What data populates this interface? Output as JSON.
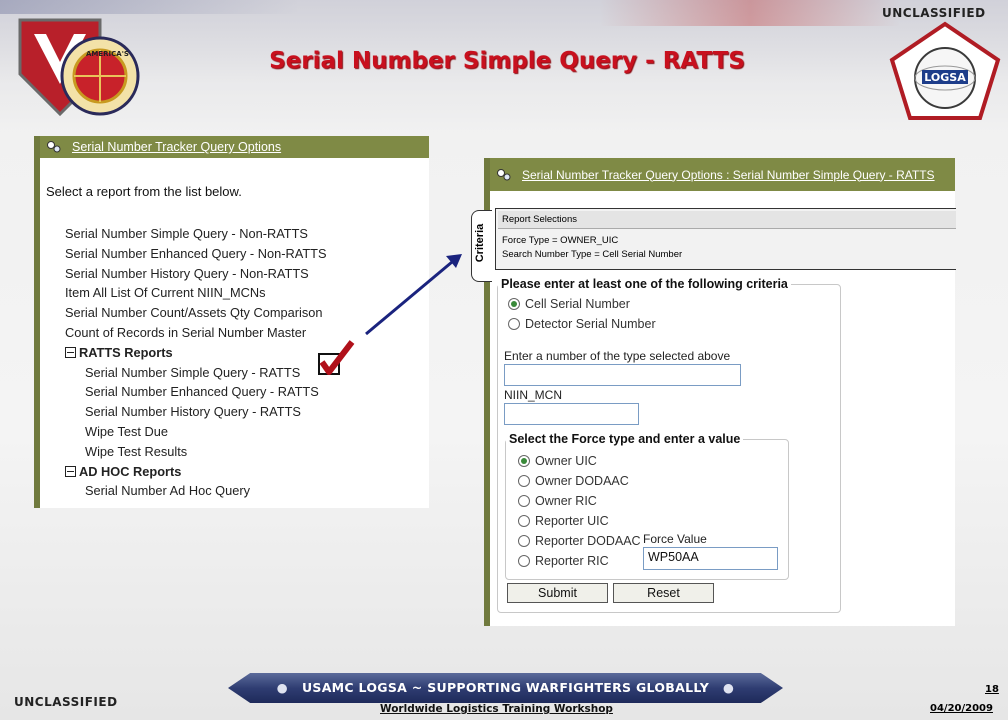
{
  "slide": {
    "title": "Serial Number Simple Query - RATTS",
    "classification_top": "UNCLASSIFIED",
    "classification_bottom": "UNCLASSIFIED",
    "banner": "USAMC LOGSA ~ SUPPORTING WARFIGHTERS GLOBALLY",
    "workshop": "Worldwide Logistics Training Workshop",
    "page_number": "18",
    "date": "04/20/2009"
  },
  "logos": {
    "left_seal_text": "AMERICA'S ARSENAL FOR THE BRAVE",
    "right_logo_text": "LOGSA"
  },
  "left_panel": {
    "header": "Serial Number Tracker Query Options",
    "prompt": "Select a report from the list below.",
    "items": [
      {
        "label": "Serial Number Simple Query - Non-RATTS"
      },
      {
        "label": "Serial Number Enhanced Query - Non-RATTS"
      },
      {
        "label": "Serial Number History Query - Non-RATTS"
      },
      {
        "label": "Item All List Of Current NIIN_MCNs"
      },
      {
        "label": "Serial Number Count/Assets Qty Comparison"
      },
      {
        "label": "Count of Records in Serial Number Master"
      }
    ],
    "ratts_group": {
      "label": "RATTS Reports",
      "items": [
        {
          "label": "Serial Number Simple Query - RATTS"
        },
        {
          "label": "Serial Number Enhanced Query - RATTS"
        },
        {
          "label": "Serial Number History Query - RATTS"
        },
        {
          "label": "Wipe Test Due"
        },
        {
          "label": "Wipe Test Results"
        }
      ]
    },
    "adhoc_group": {
      "label": "AD HOC Reports",
      "items": [
        {
          "label": "Serial Number Ad Hoc Query"
        }
      ]
    }
  },
  "right_panel": {
    "header": "Serial Number Tracker Query Options : Serial Number Simple Query - RATTS",
    "criteria_tab": "Criteria",
    "report_selections": {
      "title": "Report Selections",
      "line1": "Force Type = OWNER_UIC",
      "line2": "Search Number Type = Cell Serial Number"
    },
    "criteria_fieldset": {
      "legend": "Please enter at least one of the following criteria",
      "options": [
        {
          "label": "Cell Serial Number",
          "selected": true
        },
        {
          "label": "Detector Serial Number",
          "selected": false
        }
      ],
      "number_label": "Enter a number of the type selected above",
      "number_value": "",
      "niin_label": "NIIN_MCN",
      "niin_value": ""
    },
    "force_fieldset": {
      "legend": "Select the Force type and enter a value",
      "options": [
        {
          "label": "Owner UIC",
          "selected": true
        },
        {
          "label": "Owner DODAAC",
          "selected": false
        },
        {
          "label": "Owner RIC",
          "selected": false
        },
        {
          "label": "Reporter UIC",
          "selected": false
        },
        {
          "label": "Reporter DODAAC",
          "selected": false
        },
        {
          "label": "Reporter RIC",
          "selected": false
        }
      ],
      "force_value_label": "Force Value",
      "force_value": "WP50AA"
    },
    "buttons": {
      "submit": "Submit",
      "reset": "Reset"
    }
  },
  "colors": {
    "title_red": "#c8101e",
    "panel_header_olive": "#7f8a45",
    "banner_navy": "#2f3d72",
    "arrow_blue": "#1a237e"
  }
}
